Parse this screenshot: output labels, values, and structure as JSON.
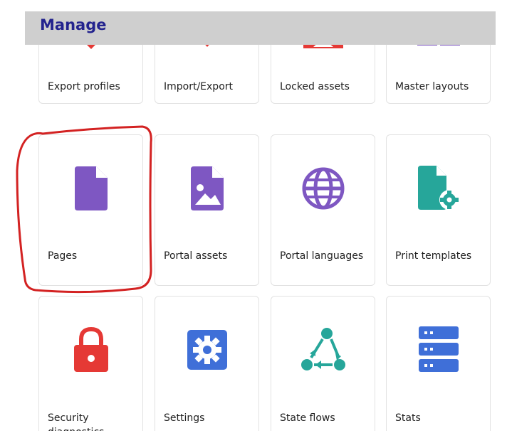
{
  "header": {
    "title": "Manage"
  },
  "tiles": [
    {
      "label": "Export profiles",
      "icon": "export-heart-icon",
      "color": "#e53935"
    },
    {
      "label": "Import/Export",
      "icon": "arrow-down-icon",
      "color": "#e53935"
    },
    {
      "label": "Locked assets",
      "icon": "locked-image-icon",
      "color": "#e53935"
    },
    {
      "label": "Master layouts",
      "icon": "layout-icon",
      "color": "#7e57c2"
    },
    {
      "label": "Pages",
      "icon": "page-icon",
      "color": "#7e57c2"
    },
    {
      "label": "Portal assets",
      "icon": "image-file-icon",
      "color": "#7e57c2"
    },
    {
      "label": "Portal languages",
      "icon": "globe-icon",
      "color": "#7e57c2"
    },
    {
      "label": "Print templates",
      "icon": "file-gear-icon",
      "color": "#26a69a"
    },
    {
      "label": "Security diagnostics",
      "icon": "lock-icon",
      "color": "#e53935"
    },
    {
      "label": "Settings",
      "icon": "gear-icon",
      "color": "#3f6fd8"
    },
    {
      "label": "State flows",
      "icon": "flow-triangle-icon",
      "color": "#26a69a"
    },
    {
      "label": "Stats",
      "icon": "server-icon",
      "color": "#3f6fd8"
    }
  ]
}
